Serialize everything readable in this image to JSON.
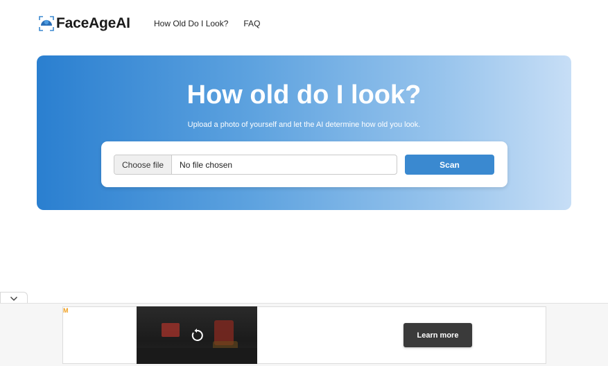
{
  "header": {
    "logo_text": "FaceAgeAI",
    "nav": [
      "How Old Do I Look?",
      "FAQ"
    ]
  },
  "hero": {
    "title": "How old do I look?",
    "subtitle": "Upload a photo of yourself and let the AI determine how old you look.",
    "choose_file_label": "Choose file",
    "file_status": "No file chosen",
    "scan_label": "Scan"
  },
  "ad": {
    "mark": "M",
    "cta_label": "Learn more"
  },
  "colors": {
    "hero_start": "#2a7fd0",
    "hero_end": "#c7def6",
    "scan_button": "#3a89d0",
    "ad_button": "#3a3a3a"
  },
  "icons": [
    "face-scan-logo-icon",
    "chevron-down-icon",
    "replay-icon"
  ]
}
